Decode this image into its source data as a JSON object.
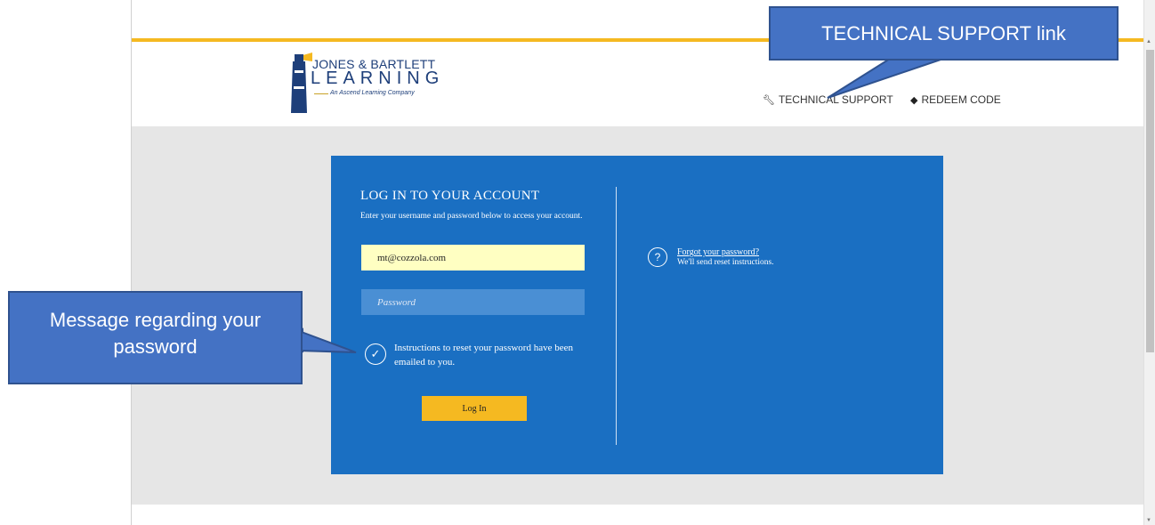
{
  "header": {
    "logo": {
      "line1": "JONES & BARTLETT",
      "line2": "LEARNING",
      "line3": "An Ascend Learning Company"
    },
    "nav": {
      "technical_support": "TECHNICAL SUPPORT",
      "technical_support_icon": "wrench-icon",
      "redeem_code": "REDEEM CODE",
      "redeem_code_icon": "tag-icon"
    }
  },
  "login": {
    "title": "LOG IN TO YOUR ACCOUNT",
    "subtitle": "Enter your username and password below to access your account.",
    "username_value": "mt@cozzola.com",
    "password_placeholder": "Password",
    "message": "Instructions to reset your password have been emailed to you.",
    "message_icon": "check-circle-icon",
    "login_button": "Log In",
    "forgot_link": "Forgot your password?",
    "forgot_note": "We'll send reset instructions.",
    "forgot_icon": "question-circle-icon"
  },
  "callouts": {
    "technical_support": "TECHNICAL SUPPORT link",
    "message": "Message regarding your password"
  },
  "colors": {
    "accent_yellow": "#f5b921",
    "card_blue": "#1a6fc2",
    "callout_blue": "#4472c4",
    "brand_navy": "#1e3f7a"
  }
}
